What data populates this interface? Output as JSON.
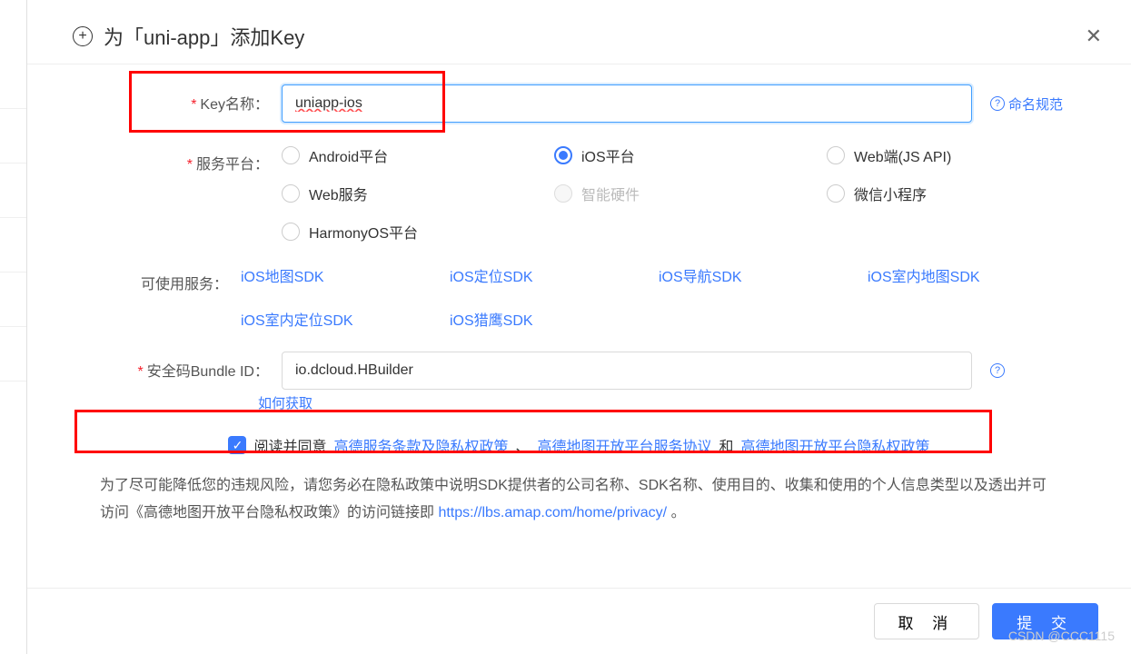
{
  "header": {
    "title": "为「uni-app」添加Key"
  },
  "keyName": {
    "label": "Key名称：",
    "value": "uniapp-ios",
    "helpText": "命名规范"
  },
  "platform": {
    "label": "服务平台：",
    "options": {
      "android": "Android平台",
      "ios": "iOS平台",
      "web": "Web端(JS API)",
      "webservice": "Web服务",
      "smart": "智能硬件",
      "wechat": "微信小程序",
      "harmony": "HarmonyOS平台"
    }
  },
  "services": {
    "label": "可使用服务：",
    "links": {
      "map": "iOS地图SDK",
      "loc": "iOS定位SDK",
      "nav": "iOS导航SDK",
      "indoorMap": "iOS室内地图SDK",
      "indoorLoc": "iOS室内定位SDK",
      "hawk": "iOS猎鹰SDK"
    }
  },
  "bundle": {
    "label": "安全码Bundle ID：",
    "value": "io.dcloud.HBuilder",
    "howToGet": "如何获取"
  },
  "agreement": {
    "prefix": "阅读并同意",
    "terms": "高德服务条款及隐私权政策",
    "sep1": "、",
    "platformAgreement": "高德地图开放平台服务协议",
    "and": "和",
    "privacy": "高德地图开放平台隐私权政策"
  },
  "note": {
    "text1": "为了尽可能降低您的违规风险，请您务必在隐私政策中说明SDK提供者的公司名称、SDK名称、使用目的、收集和使用的个人信息类型以及透出并可访问《高德地图开放平台隐私权政策》的访问链接即 ",
    "link": "https://lbs.amap.com/home/privacy/",
    "text2": "。"
  },
  "footer": {
    "cancel": "取 消",
    "submit": "提 交"
  },
  "watermark": "CSDN @CCC1115"
}
